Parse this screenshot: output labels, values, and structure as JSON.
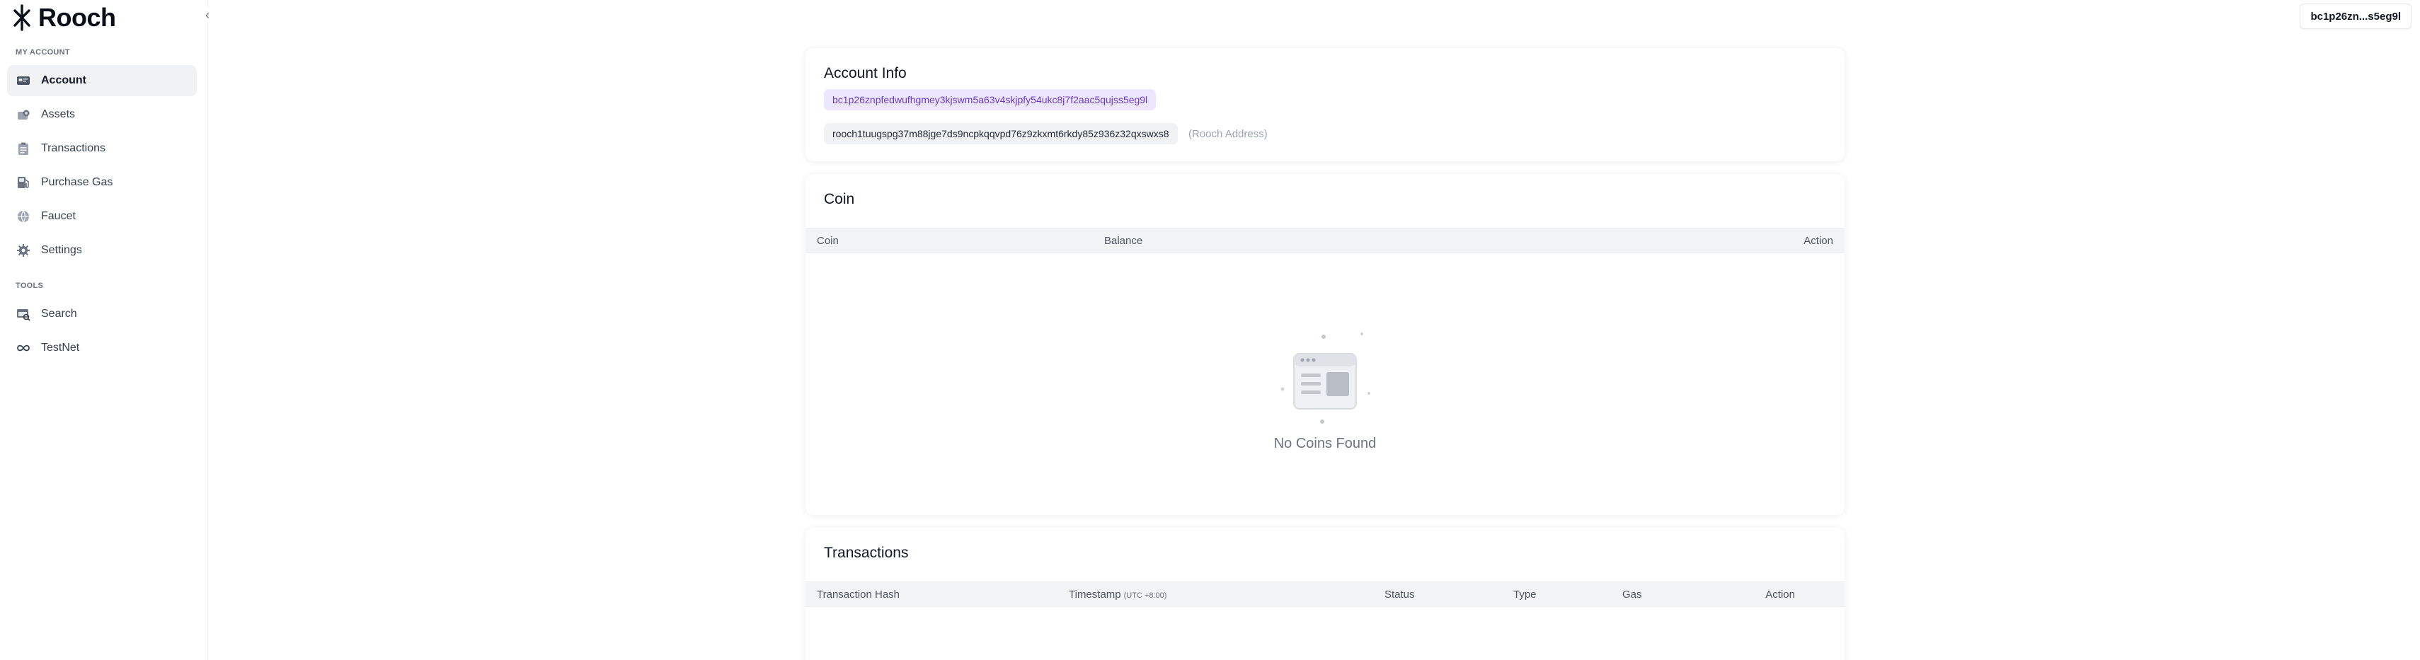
{
  "brand": {
    "name": "Rooch"
  },
  "sidebar": {
    "collapse_glyph": "‹",
    "sections": [
      {
        "label": "MY ACCOUNT",
        "items": [
          {
            "label": "Account",
            "icon": "account-card-icon",
            "active": true
          },
          {
            "label": "Assets",
            "icon": "assets-coins-icon",
            "active": false
          },
          {
            "label": "Transactions",
            "icon": "transactions-clipboard-icon",
            "active": false
          },
          {
            "label": "Purchase Gas",
            "icon": "gas-pump-icon",
            "active": false
          },
          {
            "label": "Faucet",
            "icon": "faucet-globe-icon",
            "active": false
          },
          {
            "label": "Settings",
            "icon": "settings-gear-icon",
            "active": false
          }
        ]
      },
      {
        "label": "TOOLS",
        "items": [
          {
            "label": "Search",
            "icon": "search-browser-icon",
            "active": false
          },
          {
            "label": "TestNet",
            "icon": "network-infinity-icon",
            "active": false
          }
        ]
      }
    ]
  },
  "header": {
    "wallet_label": "bc1p26zn...s5eg9l"
  },
  "account_info": {
    "title": "Account Info",
    "btc_address": "bc1p26znpfedwufhgmey3kjswm5a63v4skjpfy54ukc8j7f2aac5qujss5eg9l",
    "rooch_address": "rooch1tuugspg37m88jge7ds9ncpkqqvpd76z9zkxmt6rkdy85z936z32qxswxs8",
    "rooch_address_note": "(Rooch Address)"
  },
  "coin": {
    "title": "Coin",
    "columns": [
      "Coin",
      "Balance",
      "Action"
    ],
    "empty_text": "No Coins Found"
  },
  "transactions": {
    "title": "Transactions",
    "columns": [
      "Transaction Hash",
      "Timestamp",
      "Status",
      "Type",
      "Gas",
      "Action"
    ],
    "timestamp_suffix": "(UTC +8:00)"
  },
  "colors": {
    "accent_purple": "#6b39c9",
    "chip_purple_bg": "#ede6ff",
    "chip_gray_bg": "#f1f2f4",
    "table_head_bg": "#f3f4f6"
  }
}
